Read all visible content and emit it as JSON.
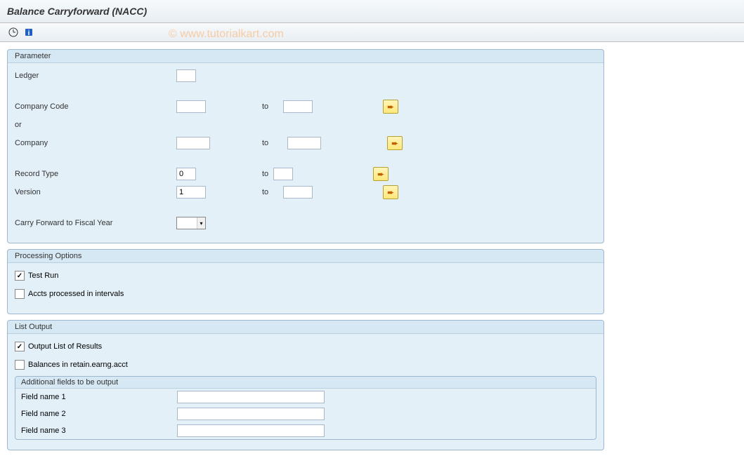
{
  "title": "Balance Carryforward (NACC)",
  "watermark": "© www.tutorialkart.com",
  "parameter": {
    "title": "Parameter",
    "ledger_label": "Ledger",
    "ledger_value": "",
    "company_code_label": "Company Code",
    "company_code_from": "",
    "company_code_to": "",
    "or_label": "or",
    "company_label": "Company",
    "company_from": "",
    "company_to": "",
    "record_type_label": "Record Type",
    "record_type_from": "0",
    "record_type_to": "",
    "version_label": "Version",
    "version_from": "1",
    "version_to": "",
    "carry_forward_label": "Carry Forward to Fiscal Year",
    "carry_forward_value": "",
    "to_label": "to"
  },
  "processing": {
    "title": "Processing Options",
    "test_run_label": "Test Run",
    "test_run_checked": true,
    "accts_intervals_label": "Accts processed in intervals",
    "accts_intervals_checked": false
  },
  "list_output": {
    "title": "List Output",
    "output_results_label": "Output List of Results",
    "output_results_checked": true,
    "balances_retain_label": "Balances in retain.earng.acct",
    "balances_retain_checked": false,
    "additional_title": "Additional fields to be output",
    "field1_label": "Field name 1",
    "field1_value": "",
    "field2_label": "Field name 2",
    "field2_value": "",
    "field3_label": "Field name 3",
    "field3_value": ""
  }
}
